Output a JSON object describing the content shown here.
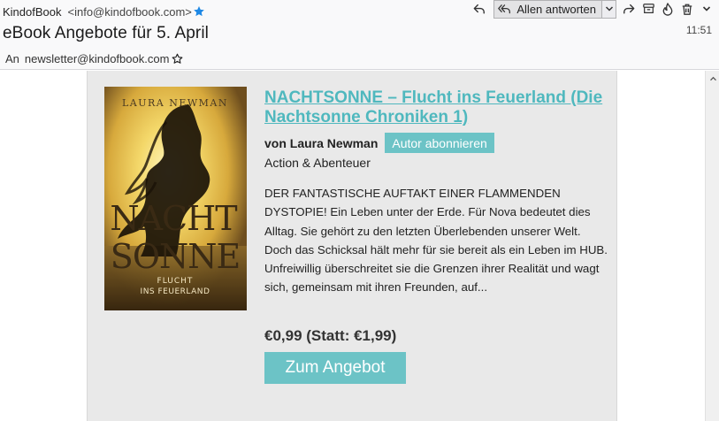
{
  "header": {
    "from_name": "KindofBook",
    "from_email": "<info@kindofbook.com>",
    "subject": "eBook Angebote für 5. April",
    "time": "11:51",
    "to_label": "An",
    "to_email": "newsletter@kindofbook.com"
  },
  "toolbar": {
    "reply_all_label": "Allen antworten",
    "buttons": [
      "reply-icon",
      "reply-all-icon",
      "chevron-down-icon",
      "forward-icon",
      "archive-icon",
      "junk-icon",
      "delete-icon",
      "more-icon"
    ]
  },
  "book": {
    "title": "NACHTSONNE – Flucht ins Feuerland (Die Nachtsonne Chroniken 1)",
    "author": "von Laura Newman",
    "subscribe_label": "Autor abonnieren",
    "genre": "Action & Abenteuer",
    "description": "DER FANTASTISCHE AUFTAKT EINER FLAMMENDEN DYSTOPIE! Ein Leben unter der Erde. Für Nova bedeutet dies Alltag. Sie gehört zu den letzten Überlebenden unserer Welt. Doch das Schicksal hält mehr für sie bereit als ein Leben im HUB. Unfreiwillig überschreitet sie die Grenzen ihrer Realität und wagt sich, gemeinsam mit ihren Freunden, auf...",
    "price": "€0,99 (Statt: €1,99)",
    "offer_label": "Zum Angebot",
    "cover_author": "LAURA NEWMAN",
    "cover_title_1": "NACHT",
    "cover_title_2": "SONNE",
    "cover_subtitle_1": "FLUCHT",
    "cover_subtitle_2": "INS FEUERLAND"
  },
  "colors": {
    "accent": "#6cc3c6",
    "title_link": "#4fb8be",
    "card_bg": "#e9e9e9",
    "header_bg": "#f9f9fa"
  }
}
